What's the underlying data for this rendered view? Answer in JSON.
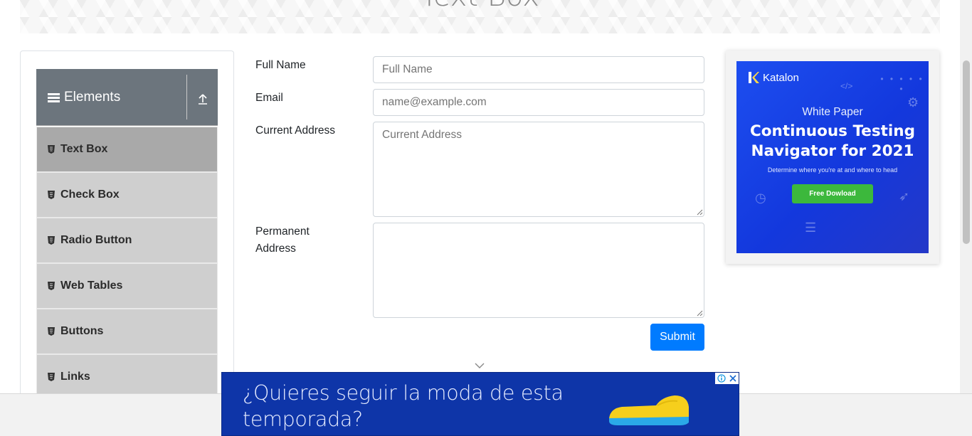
{
  "header": {
    "title": "Text Box"
  },
  "sidebar": {
    "group_title": "Elements",
    "items": [
      {
        "label": "Text Box",
        "active": true
      },
      {
        "label": "Check Box",
        "active": false
      },
      {
        "label": "Radio Button",
        "active": false
      },
      {
        "label": "Web Tables",
        "active": false
      },
      {
        "label": "Buttons",
        "active": false
      },
      {
        "label": "Links",
        "active": false
      }
    ]
  },
  "form": {
    "full_name": {
      "label": "Full Name",
      "placeholder": "Full Name",
      "value": ""
    },
    "email": {
      "label": "Email",
      "placeholder": "name@example.com",
      "value": ""
    },
    "current_address": {
      "label": "Current Address",
      "placeholder": "Current Address",
      "value": ""
    },
    "permanent_address": {
      "label_line1": "Permanent",
      "label_line2": "Address",
      "placeholder": "",
      "value": ""
    },
    "submit_label": "Submit"
  },
  "side_ad": {
    "brand": "Katalon",
    "kicker": "White Paper",
    "headline_line1": "Continuous Testing",
    "headline_line2": "Navigator for 2021",
    "subtext": "Determine where you're at and where to head",
    "cta": "Free Dowload"
  },
  "bottom_ad": {
    "text": "¿Quieres seguir la moda de esta temporada?"
  },
  "colors": {
    "primary": "#007bff",
    "sidebar_header": "#6c757d",
    "menu_item": "#cfcfcf",
    "menu_item_active": "#a9a9a9",
    "ad_blue": "#1d4ef0",
    "ad_green": "#3cb83c",
    "bottom_ad_blue": "#0e35a8"
  }
}
